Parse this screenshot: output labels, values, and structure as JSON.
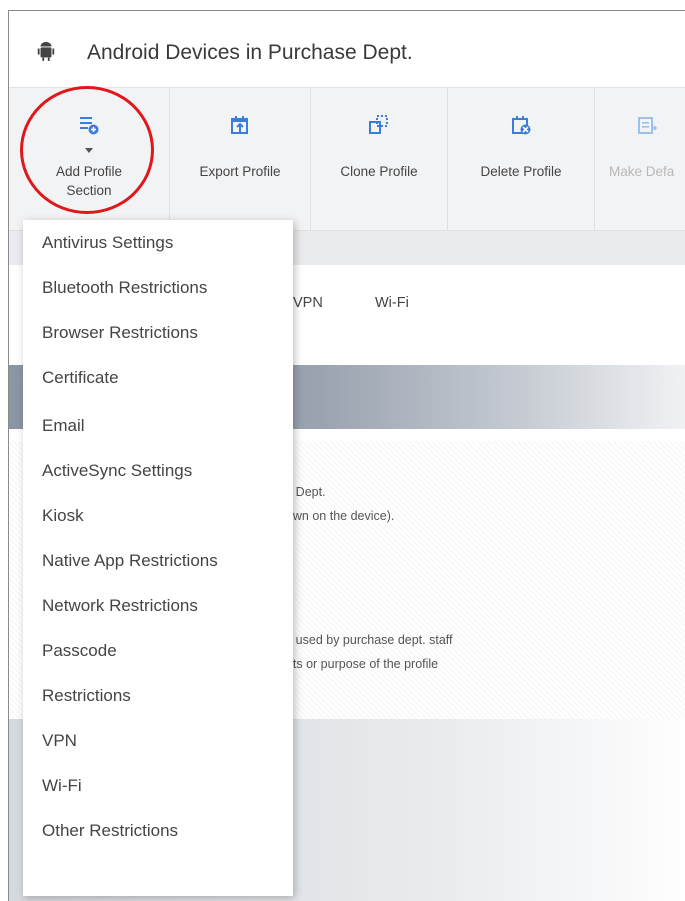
{
  "window": {
    "title": "Android Devices in Purchase Dept."
  },
  "toolbar": {
    "buttons": [
      {
        "label": "Add Profile Section",
        "icon": "add-list-icon"
      },
      {
        "label": "Export Profile",
        "icon": "export-icon"
      },
      {
        "label": "Clone Profile",
        "icon": "clone-icon"
      },
      {
        "label": "Delete Profile",
        "icon": "delete-list-icon"
      },
      {
        "label": "Make Defa",
        "icon": "make-default-icon",
        "disabled": true
      }
    ]
  },
  "background": {
    "tabs": [
      "VPN",
      "Wi-Fi"
    ],
    "text1": "se Dept.",
    "text2": "hown on the device).",
    "text3": "bs used by purchase dept. staff",
    "text4": "ents or purpose of the profile"
  },
  "dropdown": {
    "items": [
      "Antivirus Settings",
      "Bluetooth Restrictions",
      "Browser Restrictions",
      "Certificate",
      "Email",
      "ActiveSync Settings",
      "Kiosk",
      "Native App Restrictions",
      "Network Restrictions",
      "Passcode",
      "Restrictions",
      "VPN",
      "Wi-Fi",
      "Other Restrictions"
    ]
  },
  "colors": {
    "accent": "#3b7dd8",
    "highlight_circle": "#e0181b",
    "toolbar_bg": "#f2f3f5"
  }
}
